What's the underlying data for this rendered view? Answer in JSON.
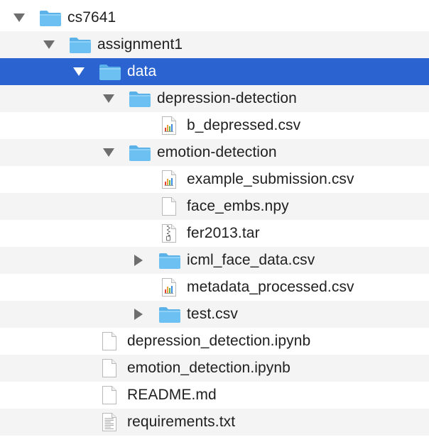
{
  "tree": [
    {
      "label": "cs7641",
      "level": 0,
      "kind": "folder",
      "expanded": true,
      "selected": false
    },
    {
      "label": "assignment1",
      "level": 1,
      "kind": "folder",
      "expanded": true,
      "selected": false
    },
    {
      "label": "data",
      "level": 2,
      "kind": "folder",
      "expanded": true,
      "selected": true
    },
    {
      "label": "depression-detection",
      "level": 3,
      "kind": "folder",
      "expanded": true,
      "selected": false
    },
    {
      "label": "b_depressed.csv",
      "level": 4,
      "kind": "csv",
      "selected": false
    },
    {
      "label": "emotion-detection",
      "level": 3,
      "kind": "folder",
      "expanded": true,
      "selected": false
    },
    {
      "label": "example_submission.csv",
      "level": 4,
      "kind": "csv",
      "selected": false
    },
    {
      "label": "face_embs.npy",
      "level": 4,
      "kind": "file",
      "selected": false
    },
    {
      "label": "fer2013.tar",
      "level": 4,
      "kind": "archive",
      "selected": false
    },
    {
      "label": "icml_face_data.csv",
      "level": 4,
      "kind": "folder",
      "expanded": false,
      "selected": false
    },
    {
      "label": "metadata_processed.csv",
      "level": 4,
      "kind": "csv",
      "selected": false
    },
    {
      "label": "test.csv",
      "level": 4,
      "kind": "folder",
      "expanded": false,
      "selected": false
    },
    {
      "label": "depression_detection.ipynb",
      "level": 2,
      "kind": "file",
      "selected": false
    },
    {
      "label": "emotion_detection.ipynb",
      "level": 2,
      "kind": "file",
      "selected": false
    },
    {
      "label": "README.md",
      "level": 2,
      "kind": "file",
      "selected": false
    },
    {
      "label": "requirements.txt",
      "level": 2,
      "kind": "text",
      "selected": false
    }
  ],
  "colors": {
    "selection": "#2b63d0",
    "folder": "#6cc0f2",
    "folder_tab": "#5ab2e8",
    "alt_row": "#f4f4f4",
    "triangle": "#6e6e6e"
  },
  "icons": {
    "folder": "folder-icon",
    "csv": "spreadsheet-file-icon",
    "file": "blank-file-icon",
    "archive": "archive-file-icon",
    "text": "text-file-icon",
    "expanded": "disclosure-triangle-down-icon",
    "collapsed": "disclosure-triangle-right-icon"
  }
}
